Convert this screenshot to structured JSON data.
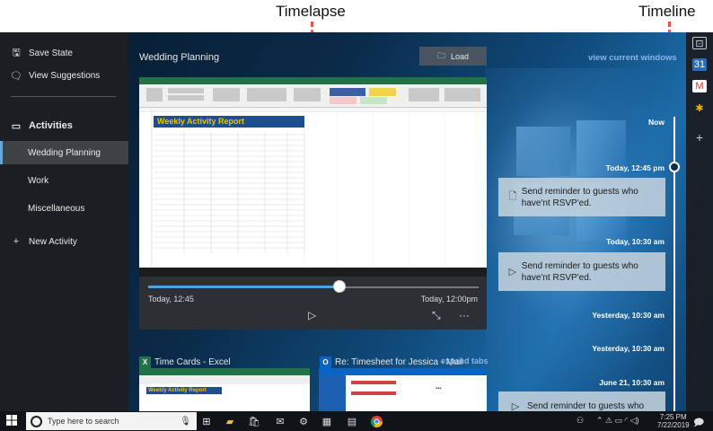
{
  "annotations": {
    "timelapse": "Timelapse",
    "timeline": "Timeline"
  },
  "sidebar": {
    "save_state": "Save State",
    "view_suggestions": "View Suggestions",
    "activities_header": "Activities",
    "activities": [
      "Wedding Planning",
      "Work",
      "Miscellaneous"
    ],
    "new_activity": "New Activity"
  },
  "main": {
    "title": "Wedding Planning",
    "load_button": "Load",
    "view_current_windows": "view current windows"
  },
  "card": {
    "sheet_title": "Weekly Activity Report",
    "start_time": "Today, 12:45",
    "end_time": "Today, 12:00pm",
    "slider_progress": 0.58
  },
  "apps": [
    {
      "name": "Time Cards - Excel",
      "icon": "excel-icon",
      "color": "#217346"
    },
    {
      "name": "Re: Timesheet for Jessica - Mail",
      "icon": "outlook-icon",
      "color": "#0a64c8"
    }
  ],
  "expand_tabs": "expand tabs",
  "timeline": {
    "labels": [
      "Now",
      "Today, 12:45 pm",
      "Today, 10:30 am",
      "Yesterday, 10:30 am",
      "Yesterday, 10:30 am",
      "June 21, 10:30 am"
    ],
    "cards": [
      "Send reminder to guests who have'nt RSVP'ed.",
      "Send reminder to guests who have'nt RSVP'ed.",
      "Send reminder to guests who"
    ]
  },
  "taskbar": {
    "search_placeholder": "Type here to search",
    "time": "7:25 PM",
    "date": "7/22/2019"
  },
  "colors": {
    "accent": "#4aa3e8",
    "annotation": "#e8534a",
    "link": "#8ab6e6"
  }
}
